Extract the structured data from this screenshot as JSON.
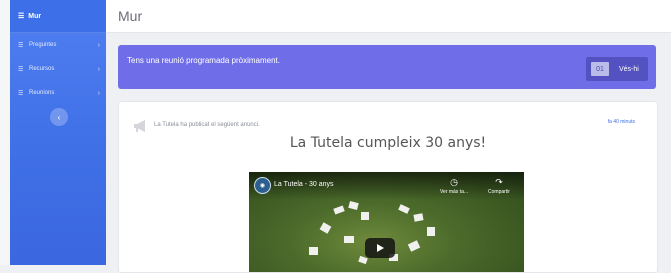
{
  "sidebar": {
    "brand": {
      "icon": "menu-icon",
      "label": "Mur"
    },
    "items": [
      {
        "icon": "list-icon",
        "label": "Preguntes"
      },
      {
        "icon": "list-icon",
        "label": "Recursos"
      },
      {
        "icon": "list-icon",
        "label": "Reunions"
      }
    ],
    "collapse_icon": "chevron-left-icon"
  },
  "header": {
    "title": "Mur"
  },
  "alert": {
    "text": "Tens una reunió programada pròximament.",
    "badge": "01",
    "button_label": "Vés-hi"
  },
  "post": {
    "posted_text": "La Tutela ha publicat el següent anunci.",
    "time_ago": "fa 40 minuts",
    "title": "La Tutela cumpleix 30 anys!"
  },
  "video": {
    "title": "La Tutela - 30 anys",
    "watch_later": "Ver más ta...",
    "share": "Compartir"
  },
  "colors": {
    "sidebar": "#4a78ee",
    "alert": "#6f6ee8",
    "link": "#3f6fe6"
  }
}
